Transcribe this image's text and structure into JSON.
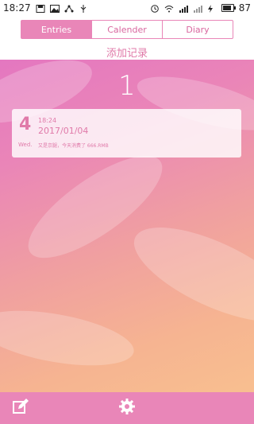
{
  "status_bar": {
    "time": "18:27",
    "battery": "87",
    "battery_level": 0.87
  },
  "tabs": [
    {
      "label": "Entries",
      "active": true
    },
    {
      "label": "Calender",
      "active": false
    },
    {
      "label": "Diary",
      "active": false
    }
  ],
  "header": {
    "add_record_label": "添加记录"
  },
  "entries_count": "1",
  "entry": {
    "day": "4",
    "time": "18:24",
    "date": "2017/01/04",
    "weekday": "Wed.",
    "note": "又是京腿，今天消费了  666.RMB"
  },
  "bottom_bar": {
    "edit_icon": "edit-icon",
    "settings_icon": "settings-gear-icon"
  },
  "colors": {
    "accent": "#e986b8",
    "accent_text": "#e07aa9"
  }
}
